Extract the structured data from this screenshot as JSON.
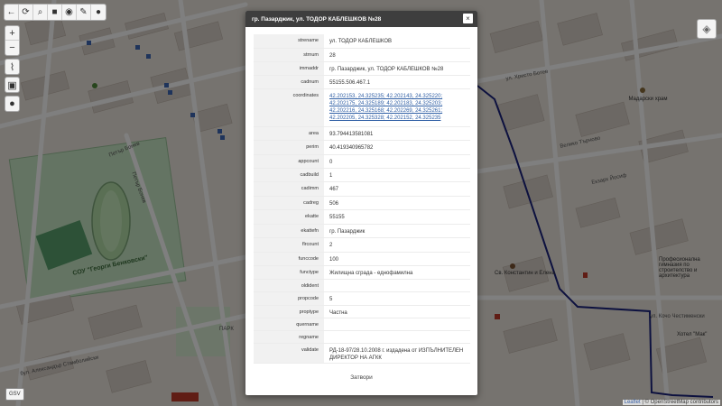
{
  "modal": {
    "title": "гр. Пазарджик, ул. ТОДОР КАБЛЕШКОВ №28",
    "close_glyph": "×",
    "footer_label": "Затвори",
    "rows": [
      {
        "key": "strename",
        "value": "ул. ТОДОР КАБЛЕШКОВ"
      },
      {
        "key": "strnum",
        "value": "28"
      },
      {
        "key": "immaddr",
        "value": "гр. Пазарджик, ул. ТОДОР КАБЛЕШКОВ №28"
      },
      {
        "key": "cadnum",
        "value": "55155.506.467.1"
      },
      {
        "key": "coordinates",
        "value": "42.202153, 24.325235; 42.202143, 24.325220; 42.202175, 24.325189; 42.202183, 24.325203; 42.202216, 24.325168; 42.202269, 24.325261; 42.202205, 24.325328; 42.202152, 24.325235"
      },
      {
        "key": "area",
        "value": "93.794413581081"
      },
      {
        "key": "perim",
        "value": "40.419340965782"
      },
      {
        "key": "appcount",
        "value": "0"
      },
      {
        "key": "cadbuild",
        "value": "1"
      },
      {
        "key": "cadimm",
        "value": "467"
      },
      {
        "key": "cadreg",
        "value": "506"
      },
      {
        "key": "ekatte",
        "value": "55155"
      },
      {
        "key": "ekattefn",
        "value": "гр. Пазарджик"
      },
      {
        "key": "flrcount",
        "value": "2"
      },
      {
        "key": "funccode",
        "value": "100"
      },
      {
        "key": "functype",
        "value": "Жилищна сграда - еднофамилна"
      },
      {
        "key": "oldident",
        "value": ""
      },
      {
        "key": "propcode",
        "value": "5"
      },
      {
        "key": "proptype",
        "value": "Частна"
      },
      {
        "key": "quername",
        "value": ""
      },
      {
        "key": "regname",
        "value": ""
      },
      {
        "key": "validate",
        "value": "РД-18-97/28.10.2008 г. издадена от ИЗПЪЛНИТЕЛЕН ДИРЕКТОР НА АГКК"
      }
    ]
  },
  "map": {
    "labels": {
      "sport": "СОУ \"Георги Бенковски\"",
      "street1": "Петър Бонев",
      "street2": "Петър Бонев",
      "street3": "бул. Александър Стамболийски",
      "street4": "ул. Кочо Честименски",
      "street5": "Екзарх Йосиф",
      "street6": "Велико Търново",
      "street7": "ул. Христо Ботев",
      "church": "Св. Константин и Елена",
      "school": "Професионална гимназия по строителство и архитектура",
      "hotel": "Хотел \"Мак\"",
      "park": "ПАРК",
      "xray": "Мадарски храм"
    },
    "gsv_label": "GSV",
    "attribution_leaflet": "Leaflet",
    "attribution_text": "| © OpenStreetMap contributors"
  },
  "colors": {
    "modal_header": "#3e3e3e",
    "link": "#2f5fa5",
    "map_route": "#1a237e"
  },
  "icons": [
    "back-icon",
    "refresh-icon",
    "search-icon",
    "stop-icon",
    "compass-icon",
    "pencil-icon",
    "comment-icon",
    "zoom-in-icon",
    "zoom-out-icon",
    "ruler-icon",
    "camera-icon",
    "marker-icon",
    "layers-icon",
    "close-icon"
  ]
}
